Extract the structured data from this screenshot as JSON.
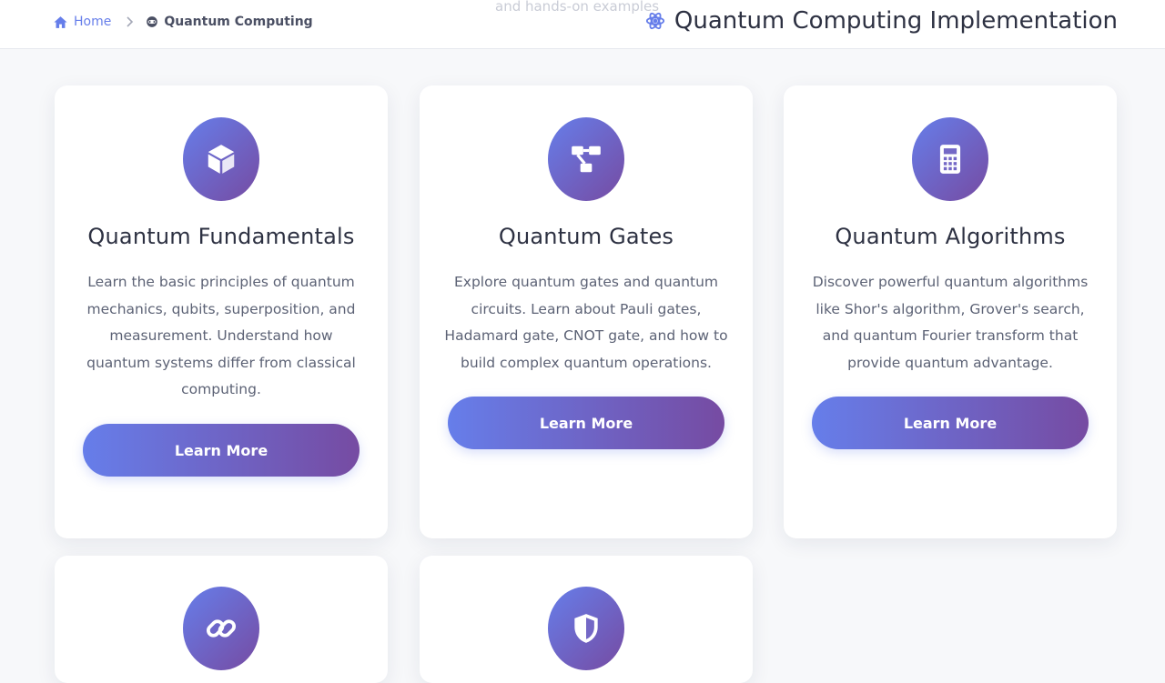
{
  "header": {
    "partial_subtitle": "and hands-on examples",
    "breadcrumb": {
      "home_label": "Home",
      "current_label": "Quantum Computing"
    },
    "page_title": "Quantum Computing Implementation"
  },
  "cards": [
    {
      "icon": "cube-icon",
      "title": "Quantum Fundamentals",
      "description": "Learn the basic principles of quantum mechanics, qubits, superposition, and measurement. Understand how quantum systems differ from classical computing.",
      "button_label": "Learn More"
    },
    {
      "icon": "project-diagram-icon",
      "title": "Quantum Gates",
      "description": "Explore quantum gates and quantum circuits. Learn about Pauli gates, Hadamard gate, CNOT gate, and how to build complex quantum operations.",
      "button_label": "Learn More"
    },
    {
      "icon": "calculator-icon",
      "title": "Quantum Algorithms",
      "description": "Discover powerful quantum algorithms like Shor's algorithm, Grover's search, and quantum Fourier transform that provide quantum advantage.",
      "button_label": "Learn More"
    },
    {
      "icon": "link-icon"
    },
    {
      "icon": "shield-icon"
    }
  ],
  "colors": {
    "accent_start": "#667eea",
    "accent_end": "#764ba2",
    "title_text": "#2d3142",
    "body_text": "#5c6275"
  }
}
